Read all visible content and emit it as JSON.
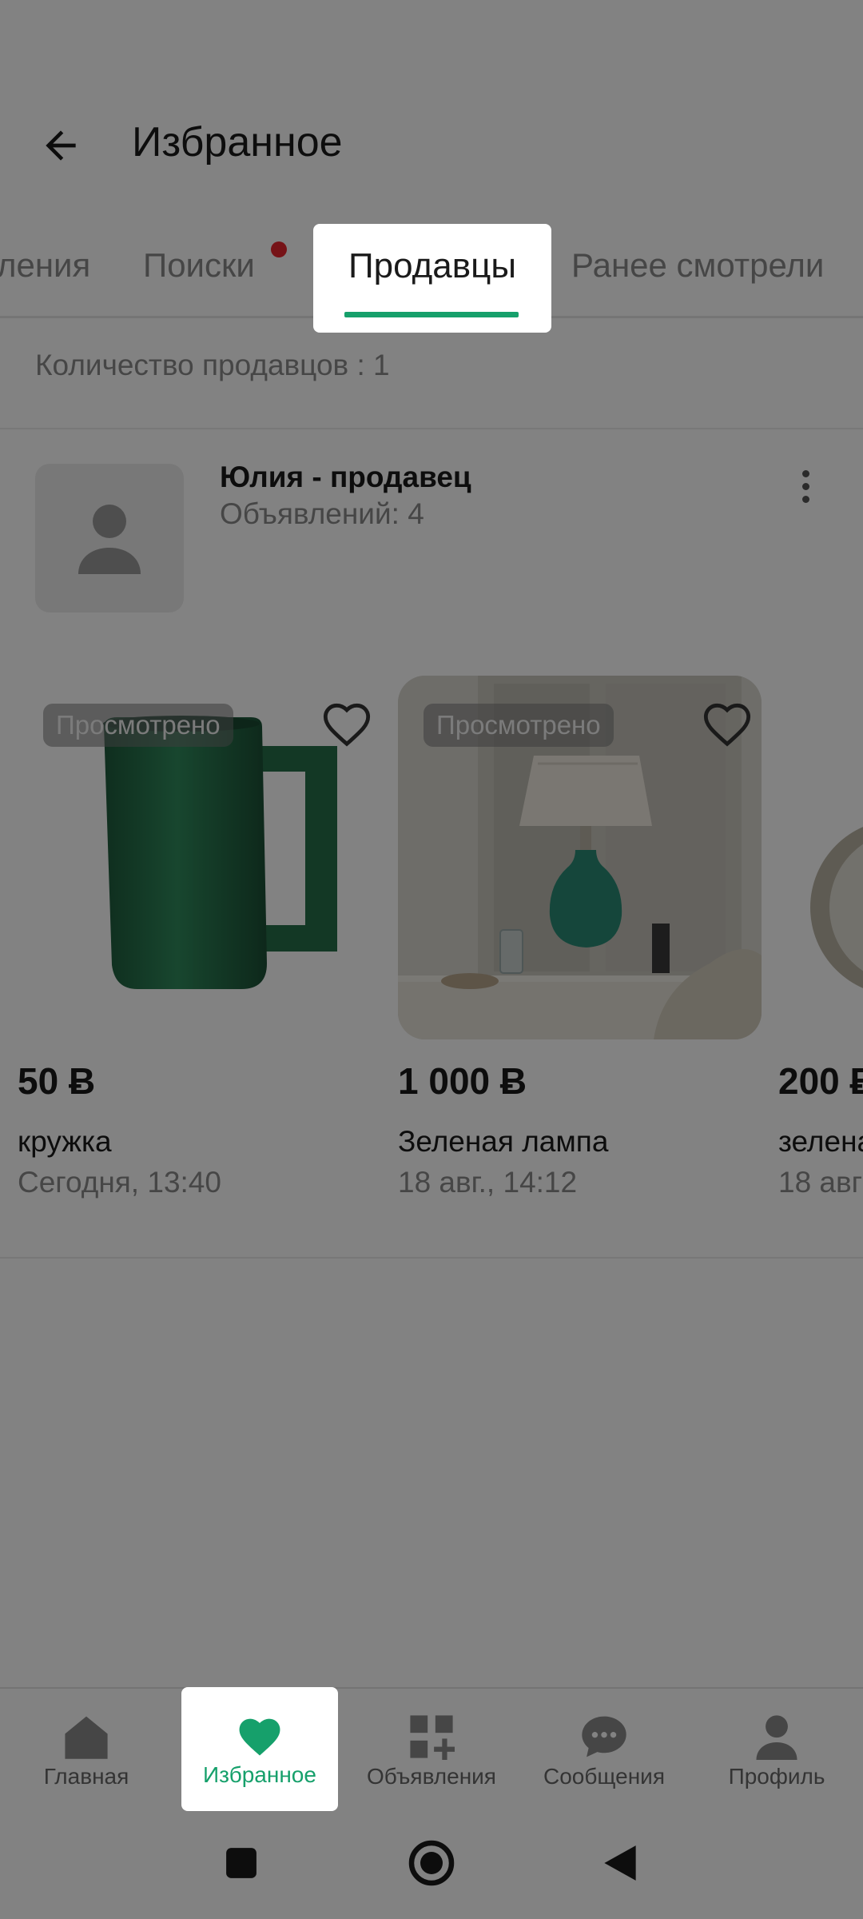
{
  "header": {
    "title": "Избранное"
  },
  "tabs": [
    {
      "label": "ления"
    },
    {
      "label": "Поиски"
    },
    {
      "label": "Продавцы"
    },
    {
      "label": "Ранее смотрели"
    }
  ],
  "count_text": "Количество продавцов : 1",
  "seller": {
    "name": "Юлия - продавец",
    "ads_count": "Объявлений: 4"
  },
  "viewed_badge": "Просмотрено",
  "items": [
    {
      "price": "50 Ƀ",
      "name": "кружка",
      "date": "Сегодня, 13:40"
    },
    {
      "price": "1 000 Ƀ",
      "name": "Зеленая лампа",
      "date": "18 авг., 14:12"
    },
    {
      "price": "200 Ƀ",
      "name": "зелена",
      "date": "18 авг"
    }
  ],
  "bottom_nav": [
    {
      "label": "Главная",
      "icon": "home-icon"
    },
    {
      "label": "Избранное",
      "icon": "heart-icon"
    },
    {
      "label": "Объявления",
      "icon": "grid-plus-icon"
    },
    {
      "label": "Сообщения",
      "icon": "chat-icon"
    },
    {
      "label": "Профиль",
      "icon": "person-icon"
    }
  ],
  "colors": {
    "accent": "#16a06b",
    "notify": "#e8262d"
  }
}
